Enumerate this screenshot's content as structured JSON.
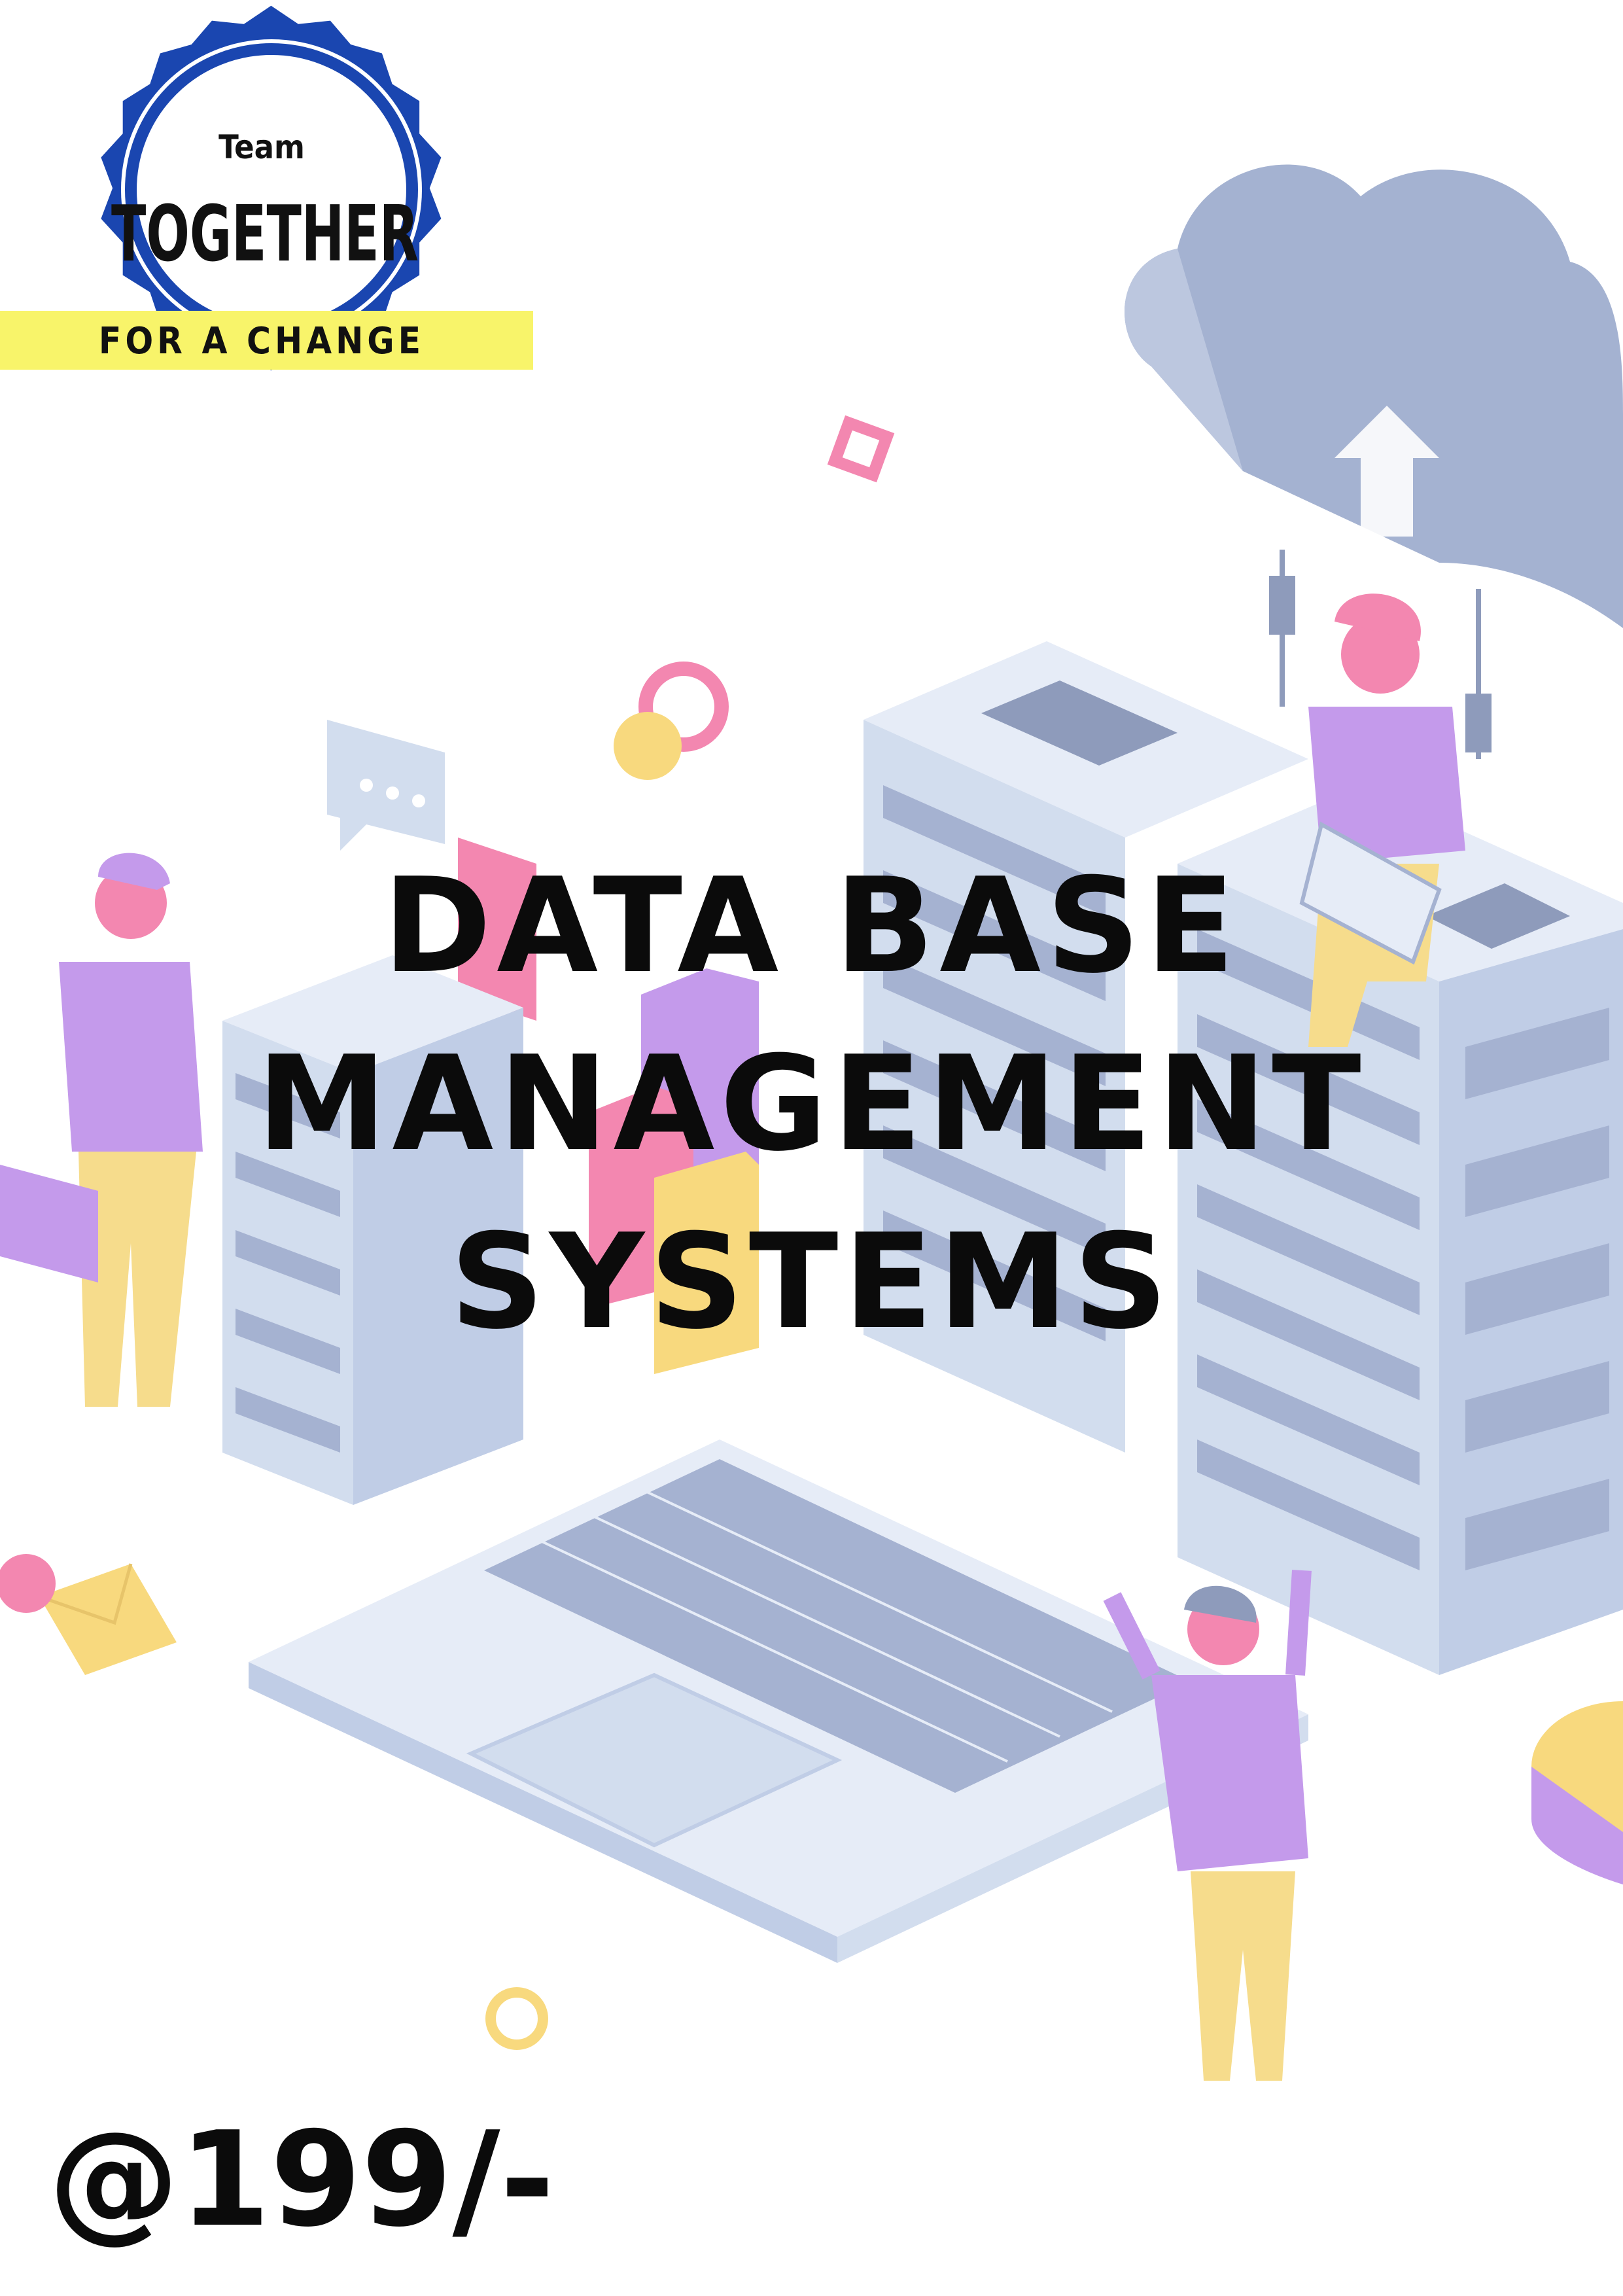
{
  "badge": {
    "top_text": "Team",
    "main_text": "TOGETHER",
    "ribbon_text": "FOR A CHANGE",
    "colors": {
      "ring": "#1a46b0",
      "ribbon": "#f8f46a"
    }
  },
  "title": {
    "line1": "DATA BASE",
    "line2": "MANAGEMENT",
    "line3": "SYSTEMS"
  },
  "price": "@199/-",
  "palette": {
    "server": "#c6d3ea",
    "server_dark": "#6e7fa8",
    "cloud": "#8a9cc4",
    "person_shirt": "#b47de6",
    "person_pants": "#f4d26b",
    "accent_pink": "#f0659a",
    "accent_yellow": "#f6cf5a"
  }
}
